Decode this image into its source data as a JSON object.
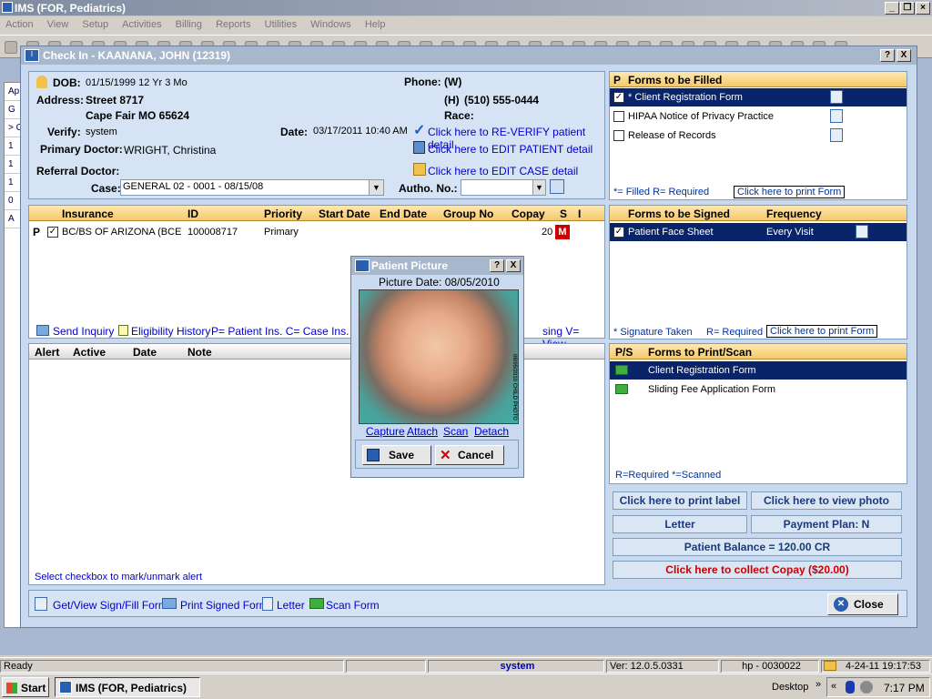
{
  "app": {
    "title": "IMS (FOR, Pediatrics)"
  },
  "menu": [
    "Action",
    "View",
    "Setup",
    "Activities",
    "Billing",
    "Reports",
    "Utilities",
    "Windows",
    "Help"
  ],
  "dialog": {
    "title": "Check In - KAANANA, JOHN  (12319)",
    "help": "?",
    "close": "X"
  },
  "patient": {
    "dob_label": "DOB:",
    "dob": "01/15/1999 12 Yr 3 Mo",
    "address_label": "Address:",
    "address1": "Street 8717",
    "address2": "Cape Fair  MO  65624",
    "verify_label": "Verify:",
    "verify": "system",
    "primary_label": "Primary Doctor:",
    "primary": "WRIGHT, Christina",
    "referral_label": "Referral Doctor:",
    "case_label": "Case:",
    "case_value": "GENERAL 02  -  0001 - 08/15/08",
    "phone_label": "Phone:",
    "phone_w": "(W)",
    "phone_h_label": "(H)",
    "phone_h": "(510) 555-0444",
    "race_label": "Race:",
    "date_label": "Date:",
    "date": "03/17/2011 10:40 AM",
    "link_reverify": "Click here to RE-VERIFY patient detail",
    "link_edit_patient": "Click here to EDIT PATIENT detail",
    "link_edit_case": "Click here to EDIT CASE detail",
    "autho_label": "Autho. No.:"
  },
  "insurance": {
    "headers": [
      "Insurance",
      "ID",
      "Priority",
      "Start Date",
      "End Date",
      "Group No",
      "Copay",
      "S",
      "I"
    ],
    "row": {
      "p": "P",
      "insurance": "BC/BS OF ARIZONA  (BCE",
      "id": "100008717",
      "priority": "Primary",
      "copay": "20",
      "s": "M"
    },
    "send_inquiry": "Send Inquiry",
    "eligibility": "Eligibility History",
    "legend": "P= Patient Ins. C= Case Ins.  S=",
    "legend2": "sing  V= View"
  },
  "alerts": {
    "headers": [
      "Alert",
      "Active",
      "Date",
      "Note"
    ],
    "footer": "Select checkbox to mark/unmark alert"
  },
  "forms_filled": {
    "headers": [
      "P",
      "Forms to be Filled"
    ],
    "items": [
      "* Client Registration Form",
      "HIPAA Notice of Privacy Practice",
      "Release of Records"
    ],
    "legend": "*= Filled   R= Required",
    "print": "Click here to print Form"
  },
  "forms_signed": {
    "headers": [
      "Forms to be Signed",
      "Frequency"
    ],
    "items": [
      {
        "name": "Patient Face Sheet",
        "freq": "Every Visit"
      }
    ],
    "legend1": "* Signature Taken",
    "legend2": "R= Required",
    "print": "Click here to print Form"
  },
  "forms_print": {
    "headers": [
      "P/S",
      "Forms to Print/Scan"
    ],
    "items": [
      "Client Registration Form",
      "Sliding Fee Application Form"
    ],
    "legend": "R=Required  *=Scanned"
  },
  "actions": {
    "print_label": "Click here to print label",
    "view_photo": "Click here to view photo",
    "letter": "Letter",
    "payment_plan": "Payment Plan: N",
    "balance": "Patient Balance = 120.00 CR",
    "collect": "Click here to collect Copay ($20.00)"
  },
  "bottom": {
    "sign": "Get/View Sign/Fill Form",
    "print_signed": "Print Signed Form",
    "letter": "Letter",
    "scan": "Scan Form",
    "close": "Close"
  },
  "picture_dialog": {
    "title": "Patient Picture",
    "help": "?",
    "close": "X",
    "date": "Picture Date: 08/05/2010",
    "capture": "Capture",
    "attach": "Attach",
    "scan": "Scan",
    "detach": "Detach",
    "save": "Save",
    "cancel": "Cancel",
    "watermark": "08/05/2010 CHILD PHOTO"
  },
  "status": {
    "ready": "Ready",
    "user": "system",
    "version": "Ver: 12.0.5.0331",
    "host": "hp - 0030022",
    "datetime": "4-24-11 19:17:53"
  },
  "taskbar": {
    "start": "Start",
    "app": "IMS (FOR, Pediatrics)",
    "desktop": "Desktop",
    "time": "7:17 PM"
  },
  "bgstrip": [
    "Ap",
    "G",
    "> C",
    "1",
    "1",
    "1",
    "0",
    "A"
  ],
  "colors": {
    "accent": "#0a246a",
    "header": "#f5c96a",
    "alert": "#cc0000"
  }
}
